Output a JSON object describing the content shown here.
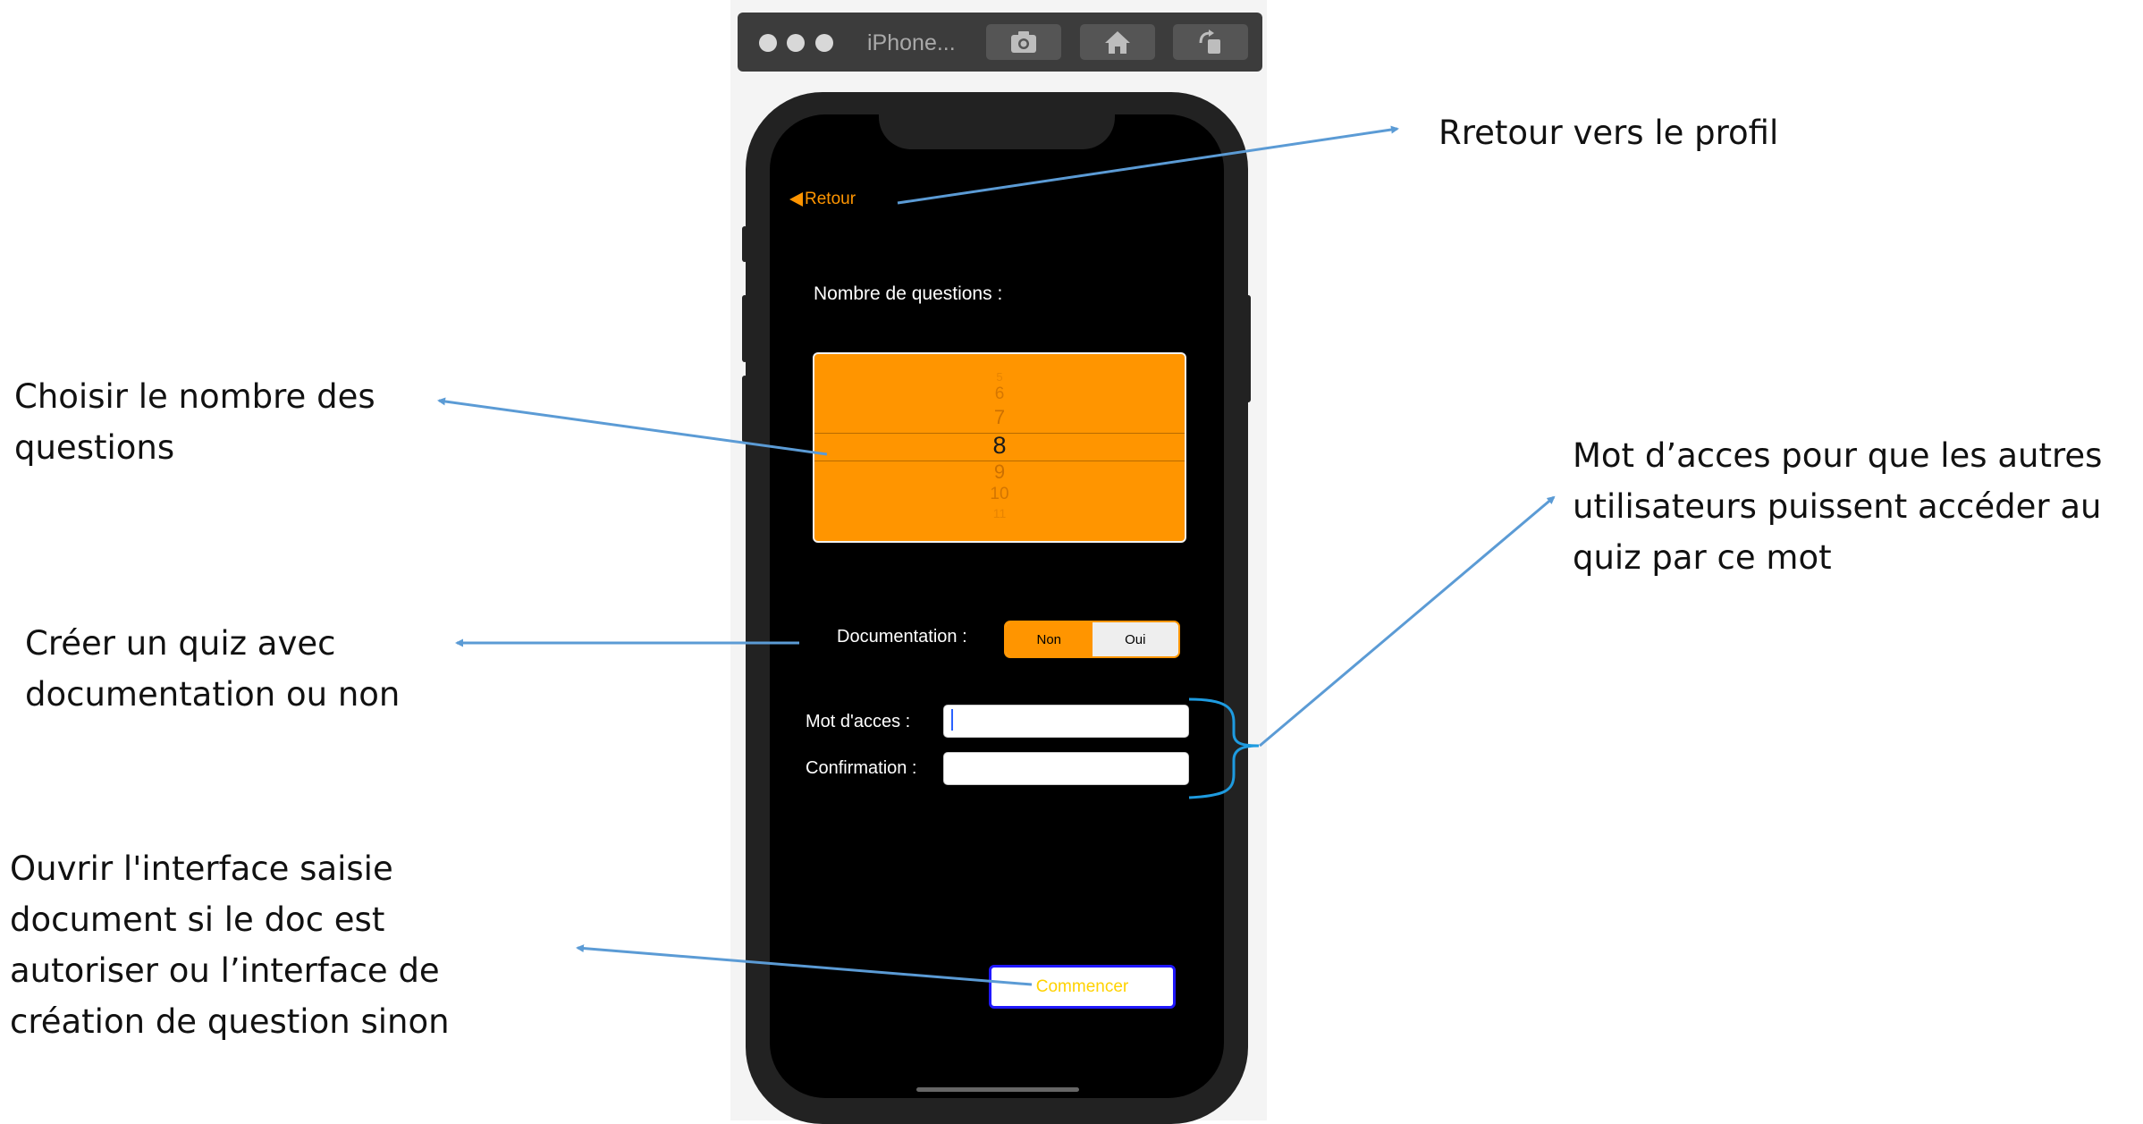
{
  "simulator": {
    "title": "iPhone...",
    "buttons": [
      {
        "icon": "camera-icon"
      },
      {
        "icon": "home-icon"
      },
      {
        "icon": "rotate-icon"
      }
    ]
  },
  "app": {
    "back_label": "Retour",
    "questions_label": "Nombre de questions :",
    "picker": {
      "options": [
        "5",
        "6",
        "7",
        "8",
        "9",
        "10",
        "11"
      ],
      "selected": "8"
    },
    "documentation": {
      "label": "Documentation :",
      "options": [
        "Non",
        "Oui"
      ],
      "selected": "Non"
    },
    "access_label": "Mot d'acces :",
    "access_value": "",
    "confirm_label": "Confirmation :",
    "confirm_value": "",
    "start_label": "Commencer"
  },
  "annotations": {
    "retour": "Rretour vers le profil",
    "nombre": "Choisir le nombre des\nquestions",
    "mot": "Mot d’acces pour que les autres\nutilisateurs puissent accéder au\nquiz par ce mot",
    "doc": "Créer un quiz avec\ndocumentation ou non",
    "commencer": "Ouvrir l'interface saisie\ndocument si le doc est\nautoriser ou l’interface de\ncréation de question sinon"
  },
  "colors": {
    "accent": "#ff9500",
    "arrow": "#5b9bd5",
    "brace": "#1e9be0",
    "button_border": "#2018ff",
    "button_text": "#ffd200"
  }
}
